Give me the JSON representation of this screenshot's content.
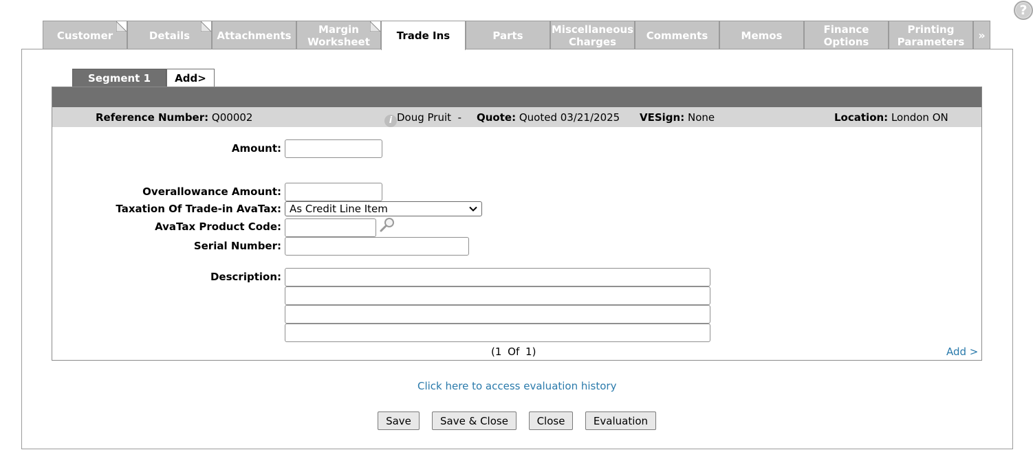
{
  "help": {
    "label": "?"
  },
  "tabs": [
    {
      "label": "Customer",
      "active": false,
      "dogear": true
    },
    {
      "label": "Details",
      "active": false,
      "dogear": true
    },
    {
      "label": "Attachments",
      "active": false,
      "dogear": false
    },
    {
      "label": "Margin Worksheet",
      "active": false,
      "dogear": true
    },
    {
      "label": "Trade Ins",
      "active": true,
      "dogear": false
    },
    {
      "label": "Parts",
      "active": false,
      "dogear": false
    },
    {
      "label": "Miscellaneous Charges",
      "active": false,
      "dogear": false
    },
    {
      "label": "Comments",
      "active": false,
      "dogear": false
    },
    {
      "label": "Memos",
      "active": false,
      "dogear": false
    },
    {
      "label": "Finance Options",
      "active": false,
      "dogear": false
    },
    {
      "label": "Printing Parameters",
      "active": false,
      "dogear": false
    }
  ],
  "more_tabs_label": "»",
  "segments": {
    "active_label": "Segment 1",
    "add_label": "Add>"
  },
  "info": {
    "ref_label": "Reference Number:",
    "ref_value": "Q00002",
    "info_icon": "i",
    "contact": "Doug Pruit",
    "separator": "-",
    "quote_label": "Quote:",
    "quote_value": "Quoted 03/21/2025",
    "vesign_label": "VESign:",
    "vesign_value": "None",
    "location_label": "Location:",
    "location_value": "London ON"
  },
  "form": {
    "amount_label": "Amount:",
    "amount_value": "",
    "overallowance_label": "Overallowance Amount:",
    "overallowance_value": "",
    "taxation_label": "Taxation Of Trade-in AvaTax:",
    "taxation_value": "As Credit Line Item",
    "product_code_label": "AvaTax Product Code:",
    "product_code_value": "",
    "serial_label": "Serial Number:",
    "serial_value": "",
    "description_label": "Description:",
    "description_lines": [
      "",
      "",
      "",
      ""
    ]
  },
  "pager": {
    "text": "(1 Of 1)"
  },
  "add_link": "Add >",
  "history_link": "Click here to access evaluation history",
  "buttons": {
    "save": "Save",
    "save_close": "Save & Close",
    "close": "Close",
    "evaluation": "Evaluation"
  },
  "colors": {
    "tab_inactive": "#c4c4c4",
    "panel_header": "#707070",
    "info_bar": "#d6d6d6",
    "link": "#2a7aab"
  }
}
